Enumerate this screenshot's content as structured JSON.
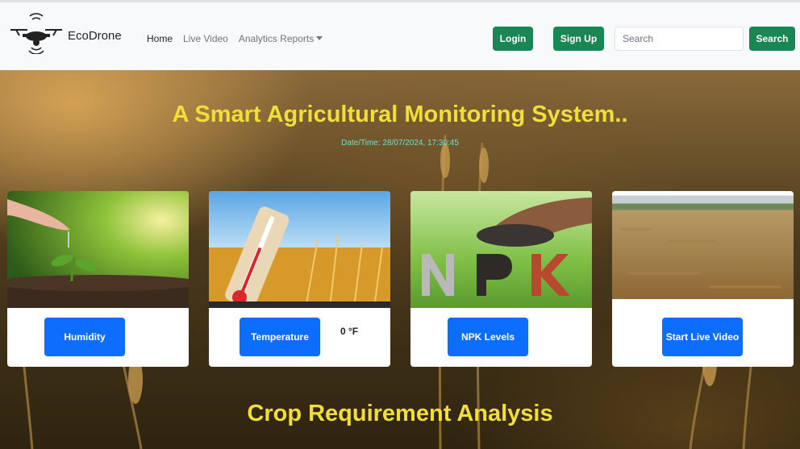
{
  "brand": {
    "name": "EcoDrone",
    "logo_icon": "drone-icon"
  },
  "nav": {
    "home": "Home",
    "live_video": "Live Video",
    "analytics": "Analytics Reports"
  },
  "auth": {
    "login": "Login",
    "signup": "Sign Up"
  },
  "search": {
    "placeholder": "Search",
    "button": "Search"
  },
  "hero": {
    "title": "A Smart Agricultural Monitoring System..",
    "datetime": "Date/Time: 28/07/2024, 17:30:45"
  },
  "cards": [
    {
      "button": "Humidity",
      "image": "seedling-water-photo"
    },
    {
      "button": "Temperature",
      "reading": "0 °F",
      "image": "thermometer-wheat-photo"
    },
    {
      "button": "NPK Levels",
      "image": "npk-fertilizer-photo"
    },
    {
      "button": "Start Live Video",
      "image": "harvested-field-photo"
    }
  ],
  "sections": {
    "crop_analysis": "Crop Requirement Analysis"
  },
  "colors": {
    "primary": "#0d6efd",
    "success": "#198754",
    "headline": "#f2de3a",
    "datetime": "#6fe0d0",
    "navbar_bg": "#f8f9fa"
  }
}
